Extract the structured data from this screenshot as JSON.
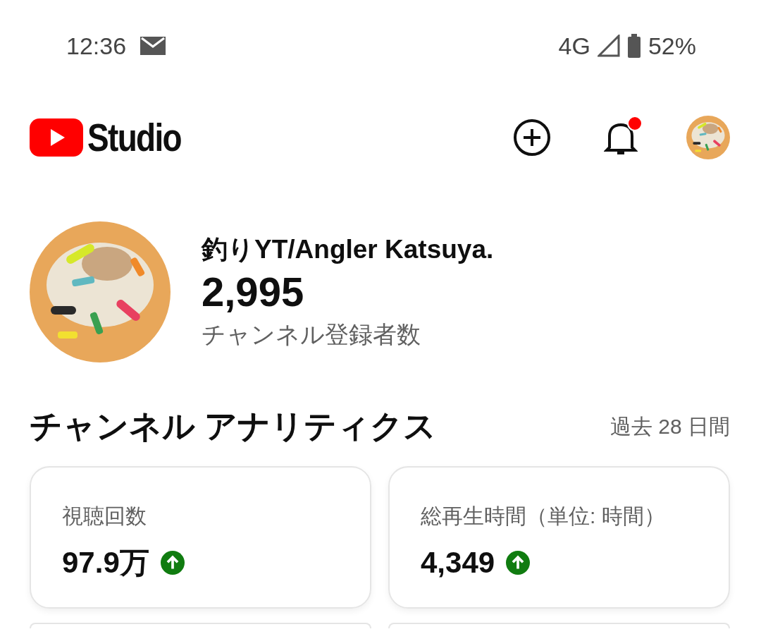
{
  "status_bar": {
    "time": "12:36",
    "network": "4G",
    "battery": "52%"
  },
  "header": {
    "app_name": "Studio",
    "has_notification": true
  },
  "channel": {
    "name": "釣りYT/Angler Katsuya.",
    "subscribers": "2,995",
    "subscribers_label": "チャンネル登録者数"
  },
  "analytics": {
    "title": "チャンネル アナリティクス",
    "period": "過去 28 日間",
    "cards": [
      {
        "label": "視聴回数",
        "value": "97.9万",
        "rising": true
      },
      {
        "label": "総再生時間（単位: 時間）",
        "value": "4,349",
        "rising": true
      }
    ]
  }
}
